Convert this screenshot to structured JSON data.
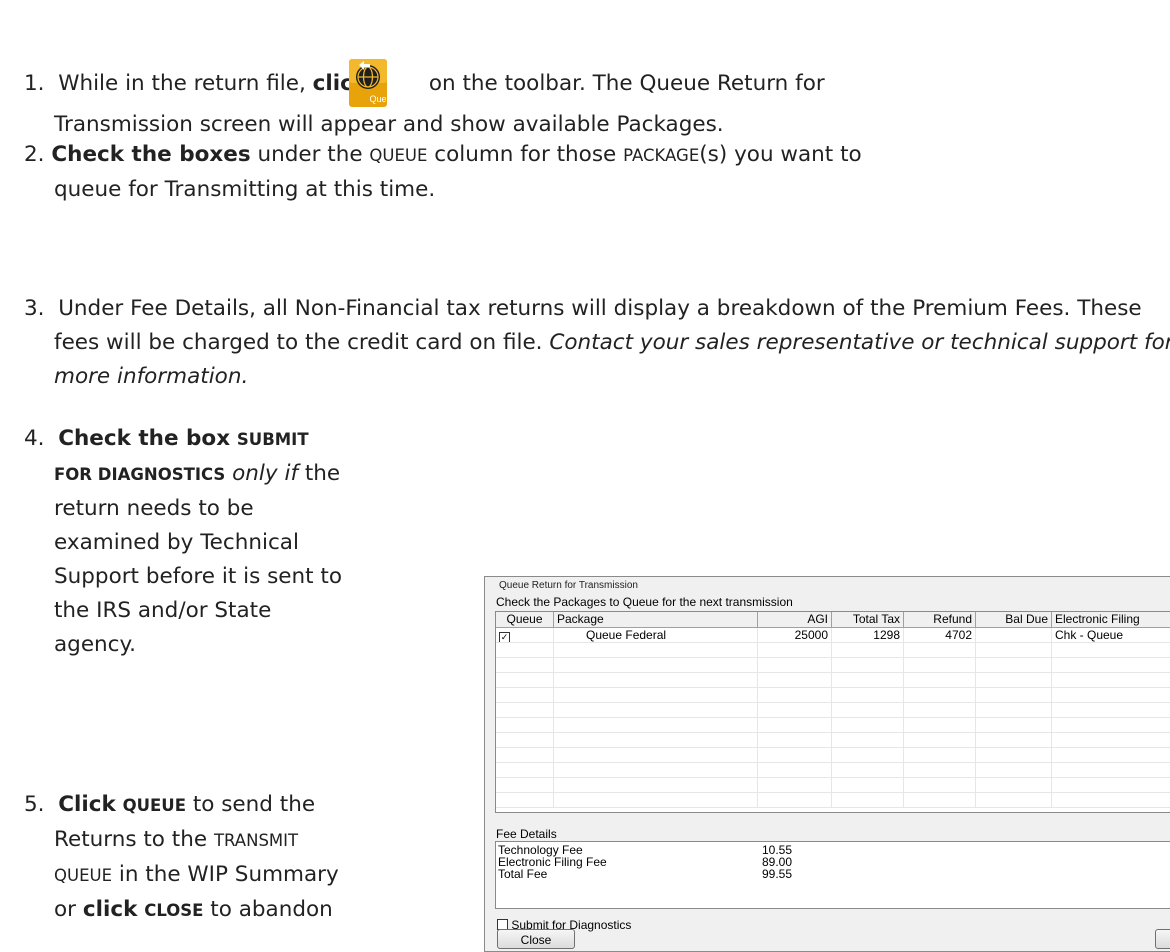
{
  "steps": {
    "s1": {
      "num": "1.",
      "pre": "While in the return file,",
      "bold": "click",
      "icon_label": "Queue",
      "post": "on the toolbar. The Queue Return for",
      "line2": "Transmission screen will appear and show available Packages."
    },
    "s2": {
      "num": "2.",
      "bold": "Check the boxes",
      "t1": "under the",
      "sc1": "Queue",
      "t2": "column for those",
      "sc2": "Package",
      "t3": "(s) you want to",
      "line2": "queue for Transmitting at this time."
    },
    "s3": {
      "num": "3.",
      "text": "Under Fee Details, all Non-Financial tax returns will display a breakdown of the Premium Fees. These fees will be charged to the credit card on file.",
      "italic": "Contact your sales representative or technical support for more information."
    },
    "s4": {
      "num": "4.",
      "bold1": "Check the box",
      "bold_sc": "Submit for Diagnostics",
      "italic": "only if",
      "text": "the return needs to be examined by Technical Support before it is sent to the IRS and/or State agency."
    },
    "s5": {
      "num": "5.",
      "bold1": "Click",
      "bold_sc1": "Queue",
      "t1": "to send the Returns to the",
      "sc1": "Transmit Queue",
      "t2": "in the WIP Summary or",
      "bold2": "click",
      "bold_sc2": "Close",
      "t3": "to abandon"
    }
  },
  "dialog": {
    "title": "Queue Return for Transmission",
    "subtitle": "Check the Packages to Queue for the next transmission",
    "columns": [
      "Queue",
      "Package",
      "AGI",
      "Total Tax",
      "Refund",
      "Bal Due",
      "Electronic Filing"
    ],
    "rows": [
      {
        "checked": true,
        "package": "Queue Federal",
        "agi": "25000",
        "total_tax": "1298",
        "refund": "4702",
        "bal_due": "",
        "efiling": "Chk - Queue"
      }
    ],
    "fee_details_label": "Fee Details",
    "fees": [
      {
        "label": "Technology Fee",
        "amount": "10.55"
      },
      {
        "label": "Electronic Filing Fee",
        "amount": "89.00"
      },
      {
        "label": "Total Fee",
        "amount": "99.55"
      }
    ],
    "diagnostics_label": "Submit for Diagnostics",
    "close_button": "Close"
  },
  "colors": {
    "icon_bg": "#e8a20a",
    "icon_globe": "#1f1f1f",
    "dialog_bg": "#f0f0f0"
  }
}
